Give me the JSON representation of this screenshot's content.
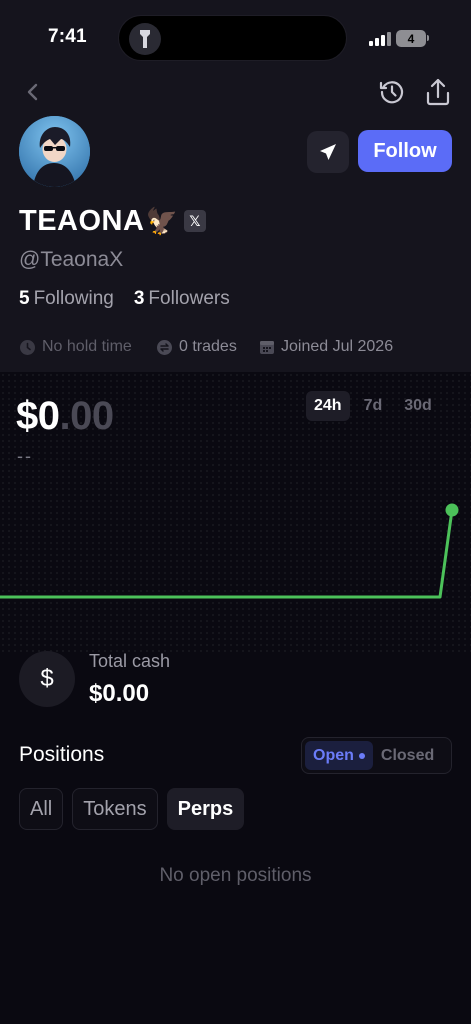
{
  "status_bar": {
    "time": "7:41",
    "battery": "4"
  },
  "profile": {
    "name": "TEAONA",
    "name_emoji": "🦅",
    "x_badge": "𝕏",
    "handle": "@TeaonaX",
    "following_count": "5",
    "following_label": "Following",
    "followers_count": "3",
    "followers_label": "Followers",
    "follow_button": "Follow",
    "meta": {
      "hold_time": "No hold time",
      "trades": "0 trades",
      "joined": "Joined Jul 2026"
    }
  },
  "portfolio": {
    "balance_whole": "$0",
    "balance_cents": ".00",
    "change": "--",
    "ranges": [
      "24h",
      "7d",
      "30d"
    ],
    "active_range": "24h"
  },
  "chart_data": {
    "type": "line",
    "color": "#4cc25a",
    "values": [
      0,
      0,
      0,
      0,
      0,
      0,
      0,
      0,
      0,
      0,
      0,
      0,
      0,
      0,
      0,
      0,
      0,
      0,
      0,
      0,
      1
    ]
  },
  "cash": {
    "icon": "dollar-icon",
    "symbol": "$",
    "label": "Total cash",
    "value": "$0.00"
  },
  "positions": {
    "title": "Positions",
    "toggle_open": "Open",
    "toggle_closed": "Closed",
    "tabs": [
      "All",
      "Tokens",
      "Perps"
    ],
    "active_tab": "Perps",
    "empty_text": "No open positions"
  },
  "colors": {
    "accent": "#5b6cf7",
    "chart_line": "#4cc25a",
    "background": "#0a0911",
    "header_bg": "#15141d"
  }
}
